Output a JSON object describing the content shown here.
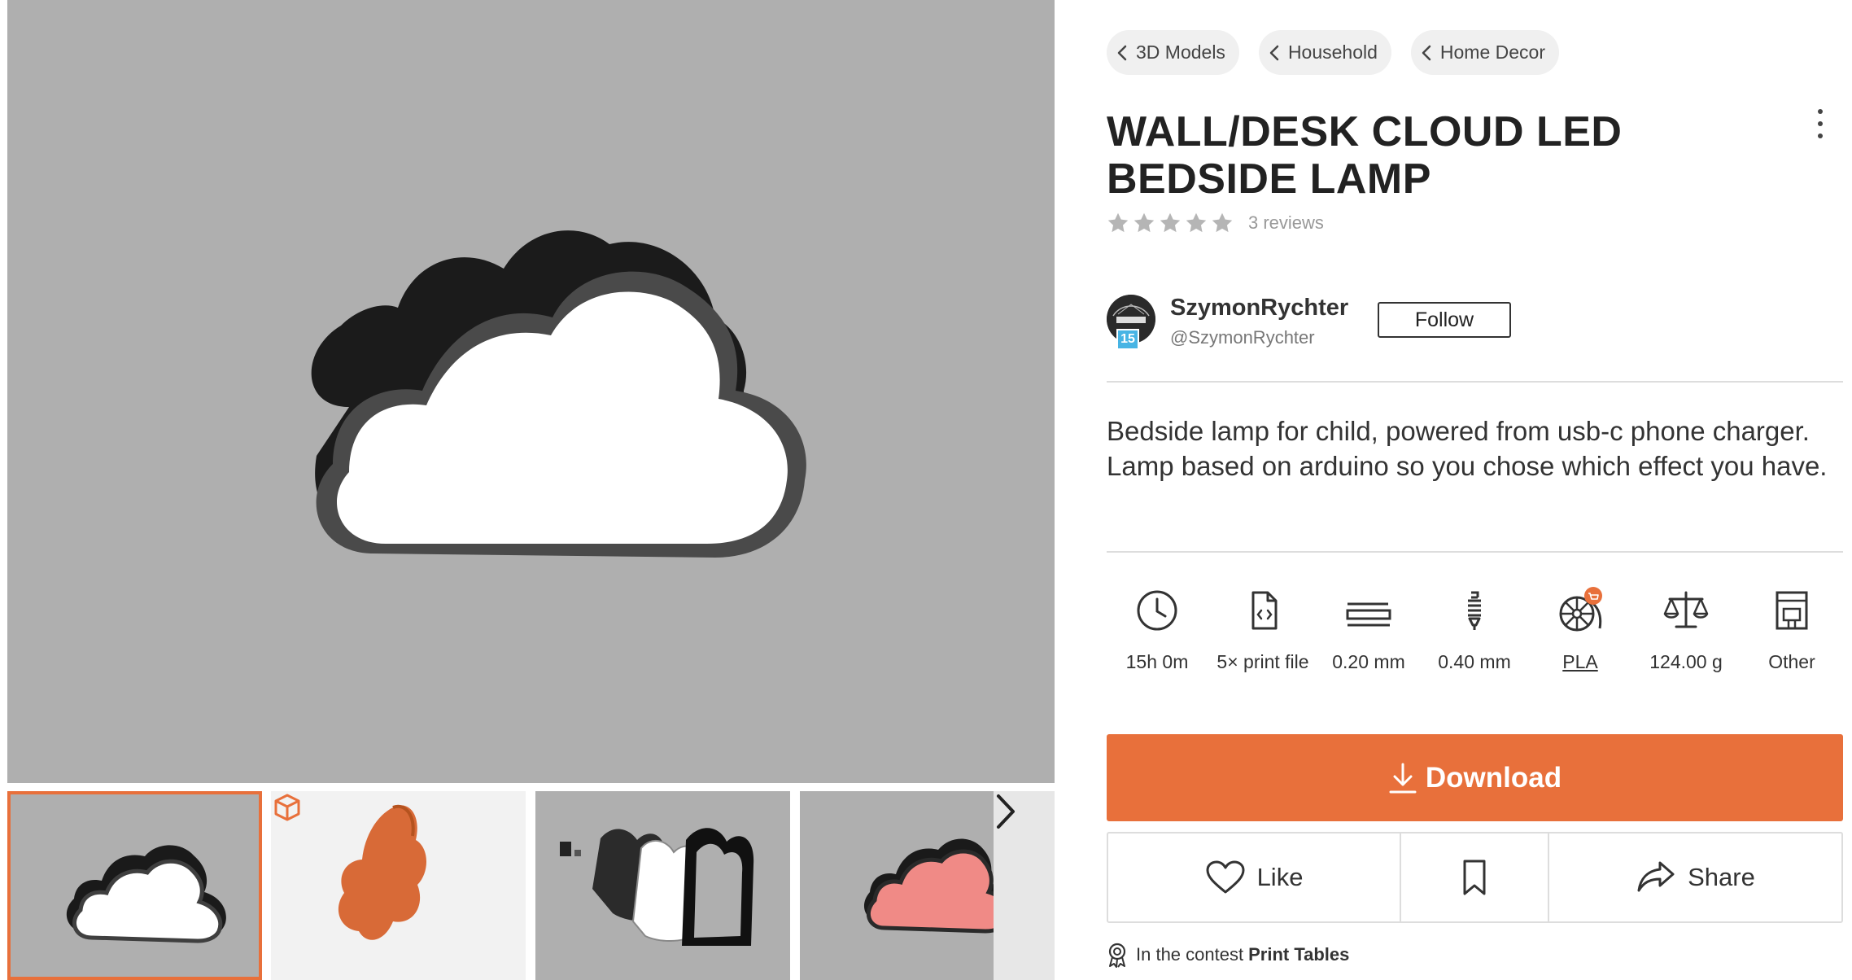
{
  "breadcrumbs": [
    {
      "label": "3D Models"
    },
    {
      "label": "Household"
    },
    {
      "label": "Home Decor"
    }
  ],
  "model": {
    "title": "WALL/DESK CLOUD LED BEDSIDE LAMP",
    "rating_stars": 5,
    "reviews_label": "3 reviews",
    "description": "Bedside lamp for child, powered from usb-c phone charger. Lamp based on arduino so you chose which effect you have."
  },
  "author": {
    "name": "SzymonRychter",
    "handle": "@SzymonRychter",
    "level": "15",
    "follow_label": "Follow"
  },
  "specs": [
    {
      "icon": "clock-icon",
      "label": "15h 0m"
    },
    {
      "icon": "print-file-icon",
      "label": "5× print file"
    },
    {
      "icon": "layer-height-icon",
      "label": "0.20 mm"
    },
    {
      "icon": "nozzle-icon",
      "label": "0.40 mm"
    },
    {
      "icon": "filament-icon",
      "label": "PLA"
    },
    {
      "icon": "weight-scale-icon",
      "label": "124.00 g"
    },
    {
      "icon": "printer-icon",
      "label": "Other"
    }
  ],
  "actions": {
    "download_label": "Download",
    "like_label": "Like",
    "share_label": "Share"
  },
  "contest": {
    "prefix": "In the contest",
    "name": "Print Tables"
  },
  "colors": {
    "accent": "#e8703b",
    "image_bg": "#afafaf",
    "level_badge": "#47b4e4"
  }
}
